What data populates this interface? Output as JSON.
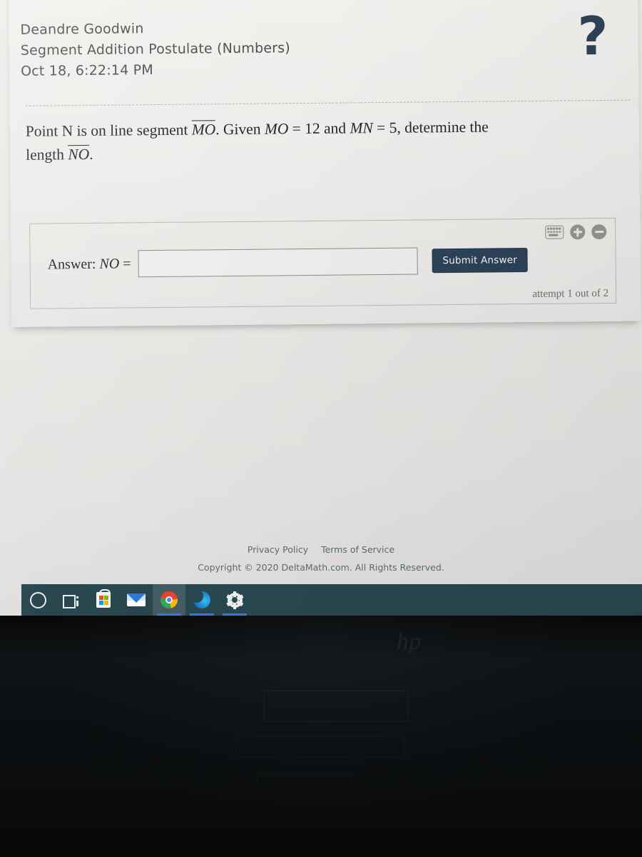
{
  "header": {
    "student_name": "Deandre Goodwin",
    "assignment_title": "Segment Addition Postulate (Numbers)",
    "timestamp": "Oct 18, 6:22:14 PM",
    "help_icon": "question-mark-icon"
  },
  "question": {
    "line1_part1": "Point N is on line segment ",
    "segment_mo": "MO",
    "line1_part2": ". Given ",
    "mo_label": "MO",
    "equals1": " = ",
    "mo_value": "12",
    "and_text": " and ",
    "mn_label": "MN",
    "equals2": " = ",
    "mn_value": "5",
    "line1_part3": ", determine the",
    "line2_part1": "length ",
    "segment_no": "NO",
    "line2_part2": "."
  },
  "answer_panel": {
    "answer_label": "Answer:",
    "answer_variable": "NO",
    "equals_sign": "=",
    "input_value": "",
    "input_placeholder": "",
    "submit_label": "Submit Answer",
    "attempt_text": "attempt 1 out of 2",
    "icons": {
      "keyboard": "keyboard-icon",
      "zoom_in": "zoom-in-icon",
      "zoom_out": "zoom-out-icon"
    }
  },
  "footer": {
    "privacy_policy": "Privacy Policy",
    "terms_of_service": "Terms of Service",
    "copyright": "Copyright © 2020 DeltaMath.com. All Rights Reserved."
  },
  "taskbar": {
    "items": [
      {
        "name": "cortana-search",
        "icon": "circle-icon"
      },
      {
        "name": "task-view",
        "icon": "task-view-icon"
      },
      {
        "name": "microsoft-store",
        "icon": "store-icon"
      },
      {
        "name": "mail",
        "icon": "mail-icon"
      },
      {
        "name": "google-chrome",
        "icon": "chrome-icon"
      },
      {
        "name": "microsoft-edge",
        "icon": "edge-icon"
      },
      {
        "name": "settings",
        "icon": "gear-icon"
      }
    ]
  },
  "monitor": {
    "brand_logo": "hp"
  },
  "colors": {
    "submit_button": "#2c4257",
    "help_icon": "#2e4257",
    "taskbar": "#29474e",
    "page_background": "#e9e7e4",
    "active_indicator": "#2f7ee0"
  }
}
